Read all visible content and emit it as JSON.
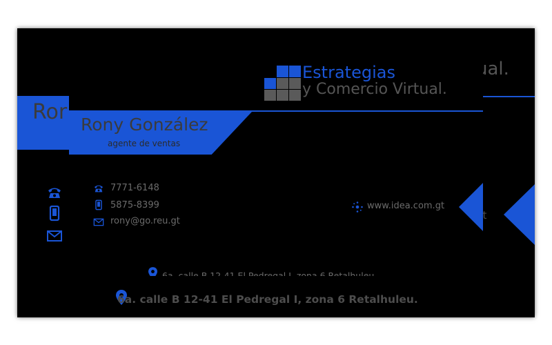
{
  "brand": {
    "name": "Estrategias",
    "tagline": "y Comercio Virtual.",
    "back_tagline_fragment": "ual.",
    "accent_color": "#1a55d6",
    "text_grey": "#6b6b6b"
  },
  "person": {
    "name": "Rony González",
    "back_name_fragment": "Ror",
    "role": "agente de ventas"
  },
  "contacts": [
    {
      "icon": "telephone-icon",
      "value": "7771-6148"
    },
    {
      "icon": "mobile-phone-icon",
      "value": "5875-8399"
    },
    {
      "icon": "envelope-icon",
      "value": "rony@go.reu.gt"
    }
  ],
  "website": {
    "icon": "web-star-icon",
    "url": "www.idea.com.gt",
    "back_fragment": "gt"
  },
  "address": {
    "icon": "location-pin-icon",
    "text": "6a. calle B 12-41 El Pedregal I, zona 6 Retalhuleu."
  }
}
